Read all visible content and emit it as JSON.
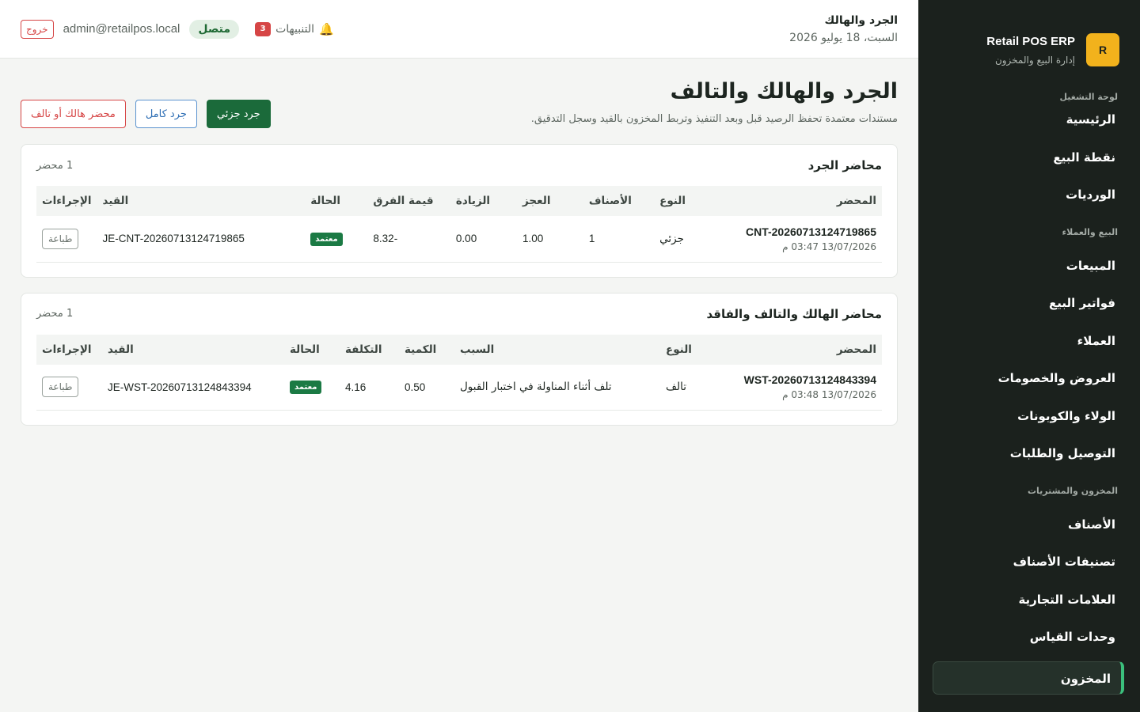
{
  "sidebar": {
    "brand_logo": "R",
    "brand_name": "Retail POS ERP",
    "brand_sub": "إدارة البيع والمخزون",
    "sections": [
      {
        "title": "لوحة التشغيل",
        "items": [
          "الرئيسية",
          "نقطة البيع",
          "الورديات"
        ]
      },
      {
        "title": "البيع والعملاء",
        "items": [
          "المبيعات",
          "فواتير البيع",
          "العملاء",
          "العروض والخصومات",
          "الولاء والكوبونات",
          "التوصيل والطلبات"
        ]
      },
      {
        "title": "المخزون والمشتريات",
        "items": [
          "الأصناف",
          "تصنيفات الأصناف",
          "العلامات التجارية",
          "وحدات القياس"
        ]
      }
    ],
    "active_item": "المخزون"
  },
  "topbar": {
    "title": "الجرد والهالك",
    "date": "السبت، 18 يوليو 2026",
    "notifications_label": "التنبيهات",
    "notifications_count": "3",
    "status": "متصل",
    "email": "admin@retailpos.local",
    "logout": "خروج"
  },
  "page": {
    "title": "الجرد والهالك والتالف",
    "description": "مستندات معتمدة تحفظ الرصيد قبل وبعد التنفيذ وتربط المخزون بالقيد وسجل التدقيق.",
    "btn_partial": "جرد جزئي",
    "btn_full": "جرد كامل",
    "btn_waste": "محضر هالك أو تالف"
  },
  "counts_card": {
    "title": "محاضر الجرد",
    "count": "1 محضر",
    "columns": [
      "المحضر",
      "النوع",
      "الأصناف",
      "العجز",
      "الزيادة",
      "قيمة الفرق",
      "الحالة",
      "القيد",
      "الإجراءات"
    ],
    "rows": [
      {
        "ref": "CNT-20260713124719865",
        "date": "13/07/2026 03:47 م",
        "type": "جزئي",
        "items": "1",
        "shortage": "1.00",
        "surplus": "0.00",
        "diff": "-8.32",
        "status": "معتمد",
        "entry": "JE-CNT-20260713124719865",
        "action": "طباعة"
      }
    ]
  },
  "waste_card": {
    "title": "محاضر الهالك والتالف والفاقد",
    "count": "1 محضر",
    "columns": [
      "المحضر",
      "النوع",
      "السبب",
      "الكمية",
      "التكلفة",
      "الحالة",
      "القيد",
      "الإجراءات"
    ],
    "rows": [
      {
        "ref": "WST-20260713124843394",
        "date": "13/07/2026 03:48 م",
        "type": "تالف",
        "reason": "تلف أثناء المناولة في اختبار القبول",
        "qty": "0.50",
        "cost": "4.16",
        "status": "معتمد",
        "entry": "JE-WST-20260713124843394",
        "action": "طباعة"
      }
    ]
  },
  "colors": {
    "sidebar_bg": "#1b211d",
    "brand_accent": "#f2b21c",
    "primary_green": "#1b6a3a",
    "danger": "#d64545",
    "active_border": "#3bbf7c"
  }
}
